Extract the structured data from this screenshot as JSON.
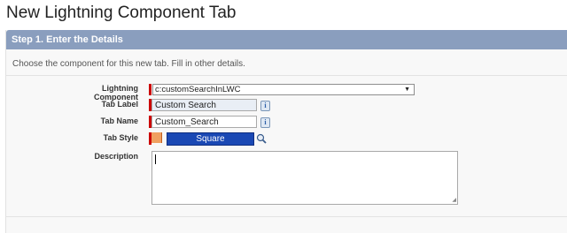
{
  "page": {
    "title": "New Lightning Component Tab"
  },
  "step": {
    "header": "Step 1. Enter the Details",
    "instruction": "Choose the component for this new tab. Fill in other details."
  },
  "form": {
    "lightning_component": {
      "label": "Lightning Component",
      "value": "c:customSearchInLWC"
    },
    "tab_label": {
      "label": "Tab Label",
      "value": "Custom Search"
    },
    "tab_name": {
      "label": "Tab Name",
      "value": "Custom_Search"
    },
    "tab_style": {
      "label": "Tab Style",
      "value": "Square"
    },
    "description": {
      "label": "Description",
      "value": ""
    }
  },
  "icons": {
    "info": "i",
    "dropdown": "▼",
    "resize": "◢"
  },
  "colors": {
    "header_bg": "#8a9ebe",
    "required": "#c00000",
    "style_button": "#1a48b4"
  }
}
